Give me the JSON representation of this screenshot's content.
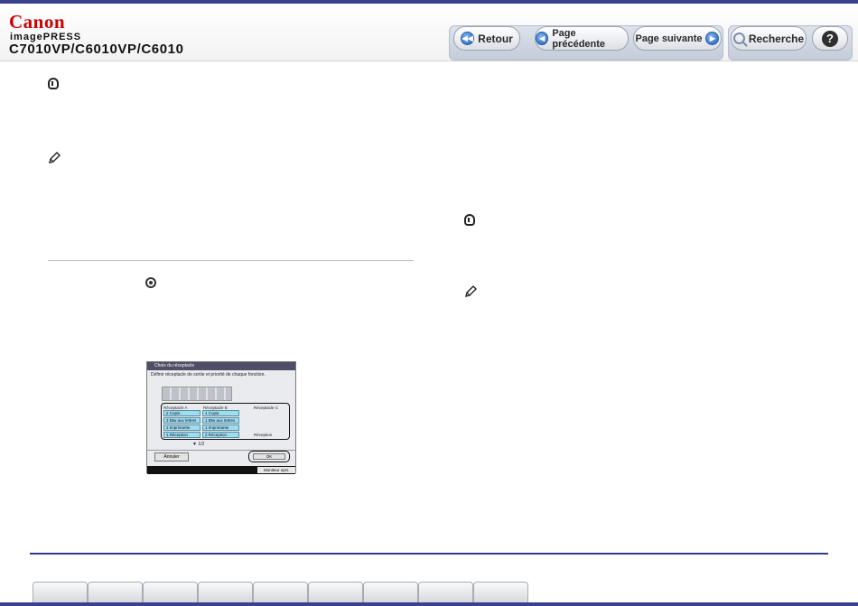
{
  "header": {
    "brand": "Canon",
    "product": "imagePRESS",
    "model": "C7010VP/C6010VP/C6010"
  },
  "nav": {
    "back_label": "Retour",
    "prev_label": "Page précédente",
    "next_label": "Page suivante",
    "search_label": "Recherche",
    "help_label": "?"
  },
  "screen": {
    "title": "Choix du réceptacle",
    "subtitle": "Définir réceptacle de sortie et priorité de chaque fonction.",
    "col_a": "Réceptacle A",
    "col_b": "Réceptacle B",
    "col_c": "Réceptacle C",
    "col_a_items": [
      "2 Copie",
      "2 Btw aux lettres",
      "2 Imprimante",
      "1 Réception"
    ],
    "col_b_items": [
      "1 Copie",
      "1 Btw aux lettres",
      "1 Imprimante",
      "2 Réception"
    ],
    "col_c_extra": "Réception",
    "pager": "1/2",
    "cancel_label": "Annuler",
    "ok_label": "OK",
    "footer_label": "Moniteur syst."
  },
  "icons": {
    "important": "important-icon",
    "memo": "memo-pencil-icon",
    "settings": "settings-key-icon"
  },
  "colors": {
    "brand_red": "#cc0000",
    "rule_blue": "#343b8f"
  }
}
